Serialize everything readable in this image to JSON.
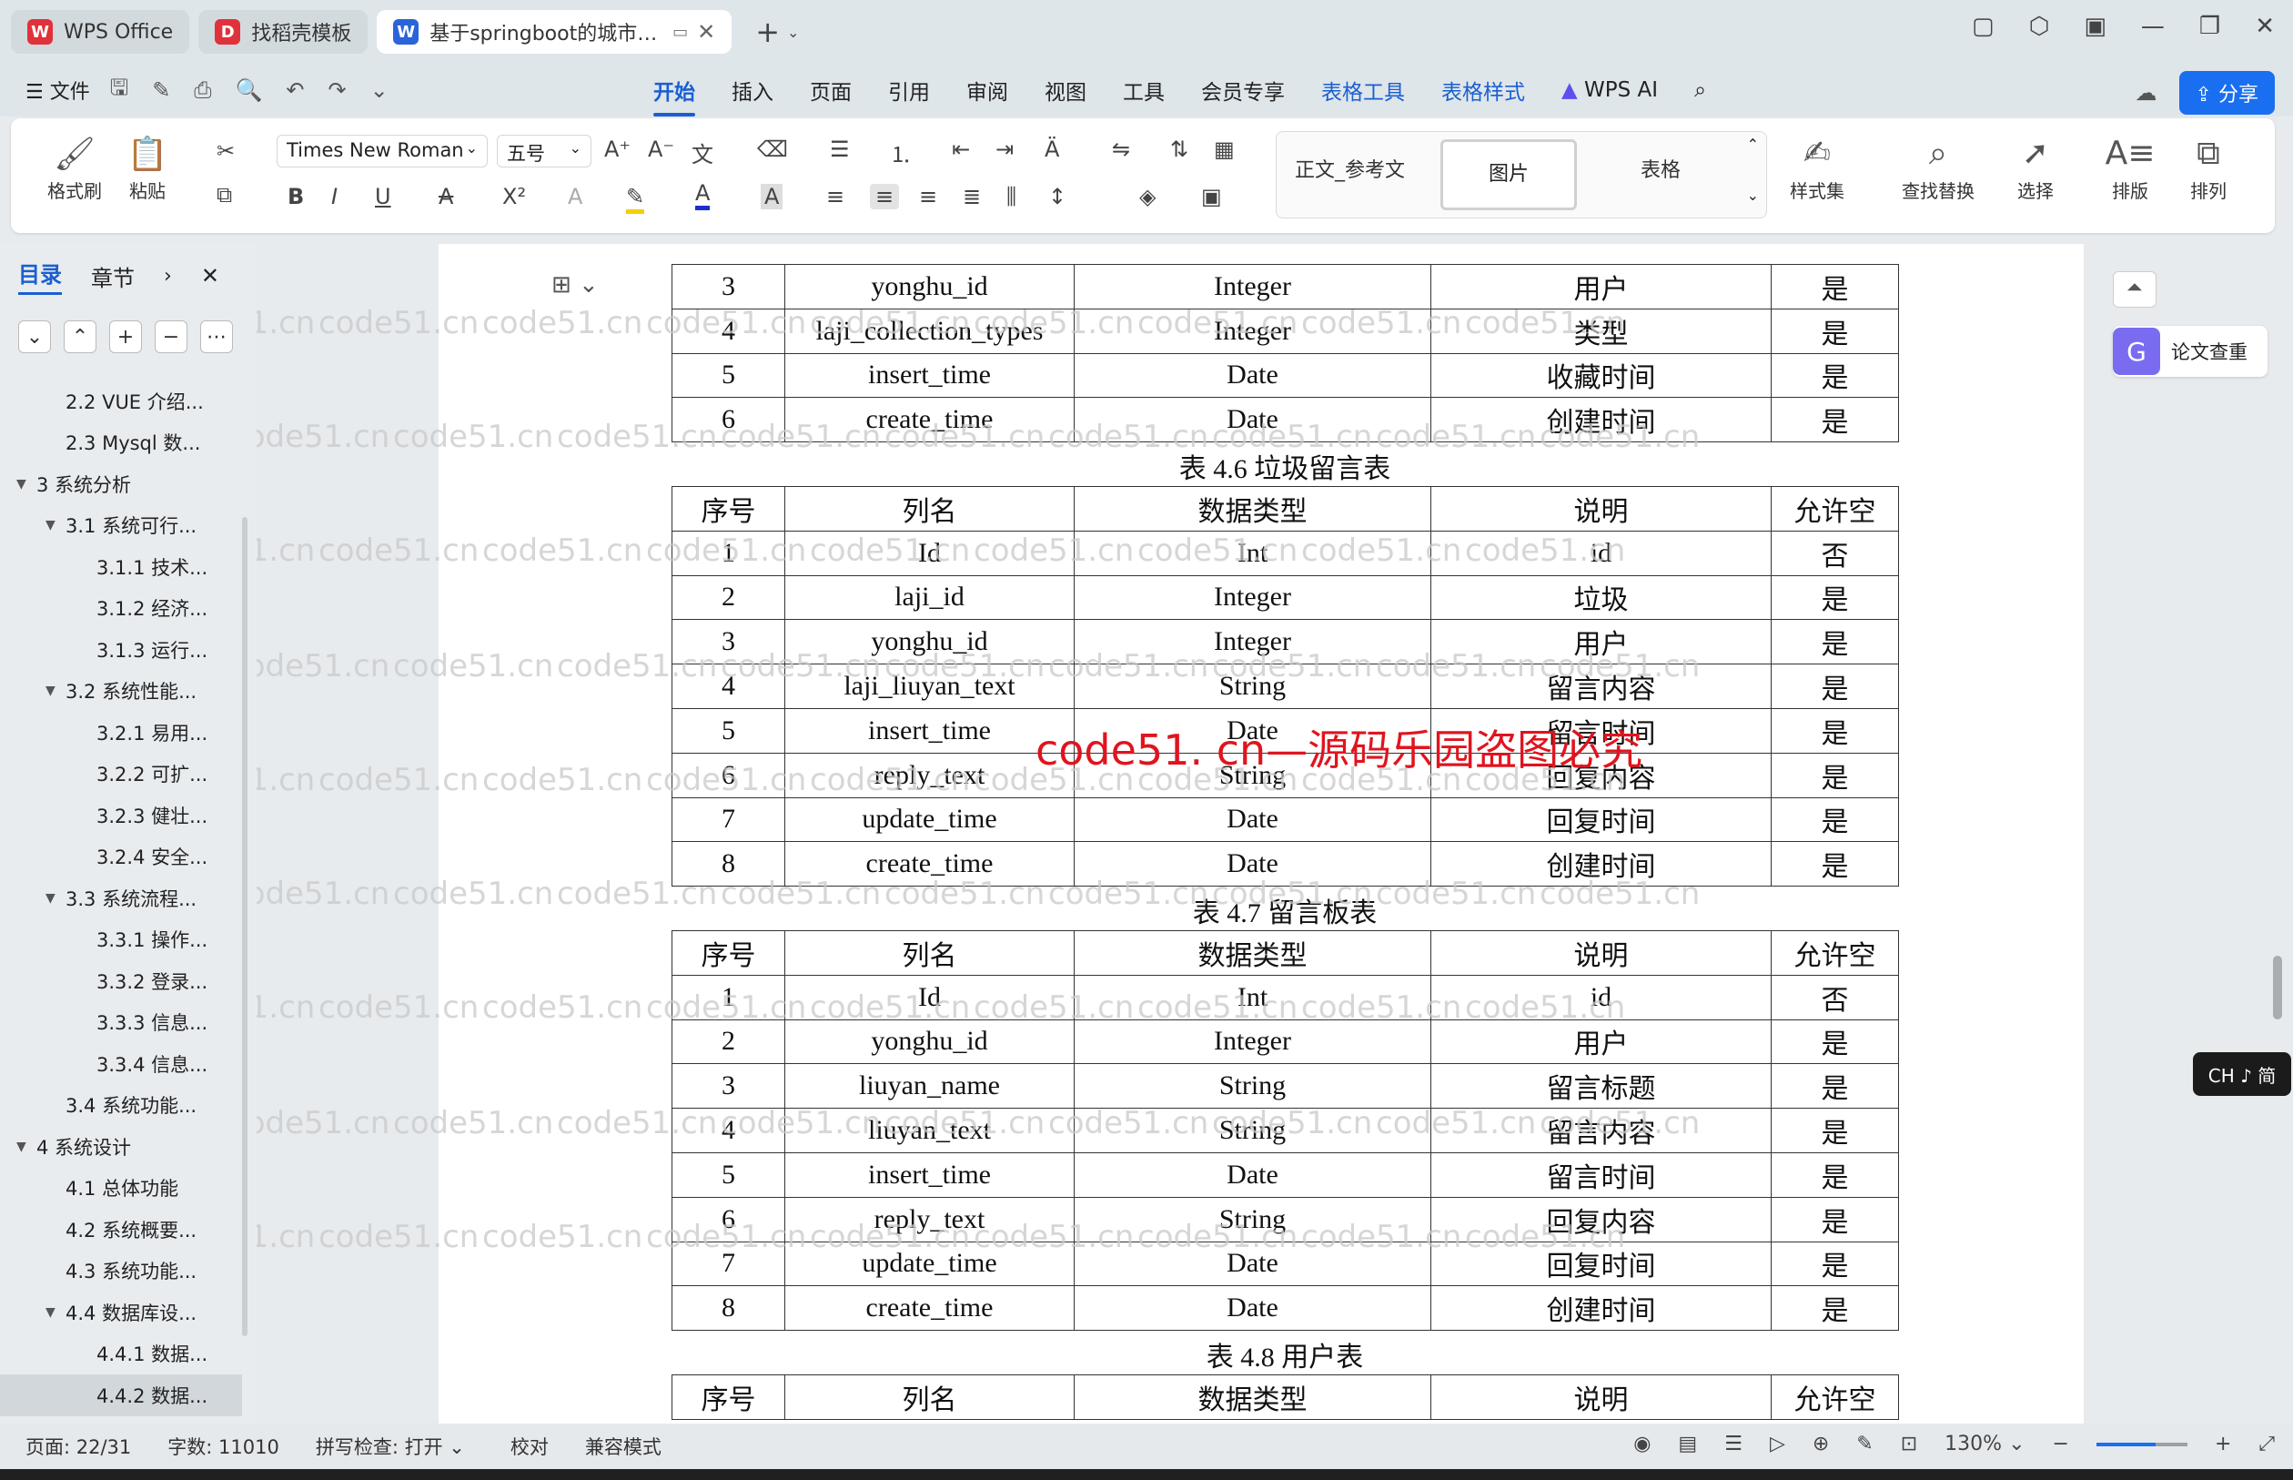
{
  "tabs": [
    {
      "label": "WPS Office",
      "icon": "wps-logo-icon",
      "color": "#e0323a"
    },
    {
      "label": "找稻壳模板",
      "icon": "docer-icon",
      "color": "#e0323a"
    },
    {
      "label": "基于springboot的城市垃圾分",
      "icon": "word-doc-icon",
      "color": "#2b63d9"
    }
  ],
  "menubar": {
    "file": "文件",
    "tabs": [
      "开始",
      "插入",
      "页面",
      "引用",
      "审阅",
      "视图",
      "工具",
      "会员专享",
      "表格工具",
      "表格样式"
    ],
    "active_tab": "开始",
    "ai": "WPS AI",
    "share": "分享"
  },
  "ribbon": {
    "format_painter": "格式刷",
    "paste": "粘贴",
    "font": "Times New Roman",
    "size": "五号",
    "styles": [
      "正文_参考文",
      "图片",
      "表格"
    ],
    "style_set": "样式集",
    "find_replace": "查找替换",
    "select": "选择",
    "typeset": "排版",
    "arrange": "排列"
  },
  "leftpane": {
    "tab_toc": "目录",
    "tab_chapter": "章节",
    "toc": [
      {
        "label": "2.2 VUE 介绍...",
        "level": 2
      },
      {
        "label": "2.3 Mysql 数...",
        "level": 2
      },
      {
        "label": "3  系统分析",
        "level": 1,
        "expanded": true
      },
      {
        "label": "3.1  系统可行...",
        "level": 2,
        "expanded": true
      },
      {
        "label": "3.1.1  技术...",
        "level": 3
      },
      {
        "label": "3.1.2  经济...",
        "level": 3
      },
      {
        "label": "3.1.3  运行...",
        "level": 3
      },
      {
        "label": "3.2  系统性能...",
        "level": 2,
        "expanded": true
      },
      {
        "label": "3.2.1  易用...",
        "level": 3
      },
      {
        "label": "3.2.2  可扩...",
        "level": 3
      },
      {
        "label": "3.2.3  健壮...",
        "level": 3
      },
      {
        "label": "3.2.4  安全...",
        "level": 3
      },
      {
        "label": "3.3  系统流程...",
        "level": 2,
        "expanded": true
      },
      {
        "label": "3.3.1  操作...",
        "level": 3
      },
      {
        "label": "3.3.2  登录...",
        "level": 3
      },
      {
        "label": "3.3.3  信息...",
        "level": 3
      },
      {
        "label": "3.3.4  信息...",
        "level": 3
      },
      {
        "label": "3.4  系统功能...",
        "level": 2
      },
      {
        "label": "4  系统设计",
        "level": 1,
        "expanded": true
      },
      {
        "label": "4.1  总体功能",
        "level": 2
      },
      {
        "label": "4.2  系统概要...",
        "level": 2
      },
      {
        "label": "4.3  系统功能...",
        "level": 2
      },
      {
        "label": "4.4  数据库设...",
        "level": 2,
        "expanded": true
      },
      {
        "label": "4.4.1  数据...",
        "level": 3
      },
      {
        "label": "4.4.2  数据...",
        "level": 3,
        "selected": true
      }
    ]
  },
  "document": {
    "header": [
      "序号",
      "列名",
      "数据类型",
      "说明",
      "允许空"
    ],
    "table_prev_rows": [
      [
        "3",
        "yonghu_id",
        "Integer",
        "用户",
        "是"
      ],
      [
        "4",
        "laji_collection_types",
        "Integer",
        "类型",
        "是"
      ],
      [
        "5",
        "insert_time",
        "Date",
        "收藏时间",
        "是"
      ],
      [
        "6",
        "create_time",
        "Date",
        "创建时间",
        "是"
      ]
    ],
    "caption_46": "表 4.6 垃圾留言表",
    "table_46": [
      [
        "1",
        "Id",
        "Int",
        "id",
        "否"
      ],
      [
        "2",
        "laji_id",
        "Integer",
        "垃圾",
        "是"
      ],
      [
        "3",
        "yonghu_id",
        "Integer",
        "用户",
        "是"
      ],
      [
        "4",
        "laji_liuyan_text",
        "String",
        "留言内容",
        "是"
      ],
      [
        "5",
        "insert_time",
        "Date",
        "留言时间",
        "是"
      ],
      [
        "6",
        "reply_text",
        "String",
        "回复内容",
        "是"
      ],
      [
        "7",
        "update_time",
        "Date",
        "回复时间",
        "是"
      ],
      [
        "8",
        "create_time",
        "Date",
        "创建时间",
        "是"
      ]
    ],
    "caption_47": "表 4.7 留言板表",
    "table_47": [
      [
        "1",
        "Id",
        "Int",
        "id",
        "否"
      ],
      [
        "2",
        "yonghu_id",
        "Integer",
        "用户",
        "是"
      ],
      [
        "3",
        "liuyan_name",
        "String",
        "留言标题",
        "是"
      ],
      [
        "4",
        "liuyan_text",
        "String",
        "留言内容",
        "是"
      ],
      [
        "5",
        "insert_time",
        "Date",
        "留言时间",
        "是"
      ],
      [
        "6",
        "reply_text",
        "String",
        "回复内容",
        "是"
      ],
      [
        "7",
        "update_time",
        "Date",
        "回复时间",
        "是"
      ],
      [
        "8",
        "create_time",
        "Date",
        "创建时间",
        "是"
      ]
    ],
    "caption_48": "表 4.8 用户表",
    "red_watermark": "code51. cn—源码乐园盗图必究",
    "watermark": "code51.cn"
  },
  "rightpane": {
    "paper_check": "论文查重",
    "ime": "CH ♪ 简"
  },
  "status": {
    "page": "页面: 22/31",
    "words": "字数: 11010",
    "spell": "拼写检查: 打开",
    "proof": "校对",
    "compat": "兼容模式",
    "zoom": "130%",
    "zoom_level": 0.65
  }
}
